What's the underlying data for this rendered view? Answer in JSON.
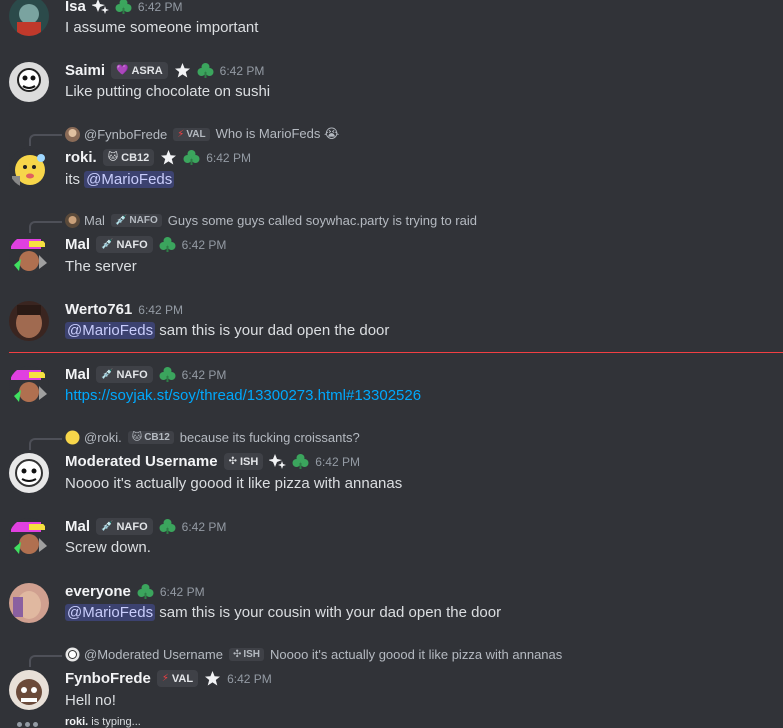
{
  "colors": {
    "background": "#313338",
    "mention_bg": "#3c4270",
    "link": "#00a8fc",
    "new_divider": "#f23f43"
  },
  "messages": [
    {
      "username": "Isa",
      "time": "6:42 PM",
      "text": "I assume someone important",
      "icons": [
        "sparkle-stars-icon",
        "green-clover-icon"
      ]
    },
    {
      "username": "Saimi",
      "tag": "ASRA",
      "tag_icon": "💜",
      "time": "6:42 PM",
      "text": "Like putting chocolate on sushi",
      "icons": [
        "star-badge-icon",
        "green-clover-icon"
      ]
    },
    {
      "reply": {
        "name": "@FynboFrede",
        "tag": "VAL",
        "tag_icon": "⚡",
        "text": "Who is MarioFeds 😭"
      },
      "username": "roki.",
      "tag": "CB12",
      "tag_icon": "🐱",
      "time": "6:42 PM",
      "text_prefix": "its ",
      "mention": "@MarioFeds",
      "icons": [
        "star-badge-icon",
        "green-clover-icon"
      ]
    },
    {
      "reply": {
        "name": "Mal",
        "tag": "NAFO",
        "tag_icon": "💉",
        "text": "Guys some guys called soywhac.party is trying to raid"
      },
      "username": "Mal",
      "tag": "NAFO",
      "tag_icon": "💉",
      "time": "6:42 PM",
      "text": "The server",
      "icons": [
        "green-clover-icon"
      ]
    },
    {
      "username": "Werto761",
      "time": "6:42 PM",
      "mention": "@MarioFeds",
      "text_suffix": " sam this is your dad open the door"
    },
    {
      "username": "Mal",
      "tag": "NAFO",
      "tag_icon": "💉",
      "time": "6:42 PM",
      "link": "https://soyjak.st/soy/thread/13300273.html#13302526",
      "icons": [
        "green-clover-icon"
      ]
    },
    {
      "reply": {
        "name": "@roki.",
        "tag": "CB12",
        "tag_icon": "🐱",
        "text": "because its fucking croissants?"
      },
      "username": "Moderated Username",
      "tag": "ISH",
      "tag_icon": "✣",
      "time": "6:42 PM",
      "text": "Noooo it's actually goood it like pizza with annanas",
      "icons": [
        "sparkle-stars-icon",
        "green-clover-icon"
      ]
    },
    {
      "username": "Mal",
      "tag": "NAFO",
      "tag_icon": "💉",
      "time": "6:42 PM",
      "text": "Screw down.",
      "icons": [
        "green-clover-icon"
      ]
    },
    {
      "username": "everyone",
      "time": "6:42 PM",
      "mention": "@MarioFeds",
      "text_suffix": " sam this is your cousin with your dad open the door",
      "icons": [
        "green-clover-icon"
      ]
    },
    {
      "reply": {
        "name": "@Moderated Username",
        "tag": "ISH",
        "tag_icon": "✣",
        "text": "Noooo it's actually goood it like pizza with annanas"
      },
      "username": "FynboFrede",
      "tag": "VAL",
      "tag_icon": "⚡",
      "time": "6:42 PM",
      "text": "Hell no!",
      "icons": [
        "star-badge-icon"
      ]
    }
  ],
  "typing": {
    "user": "roki.",
    "text": " is typing..."
  }
}
